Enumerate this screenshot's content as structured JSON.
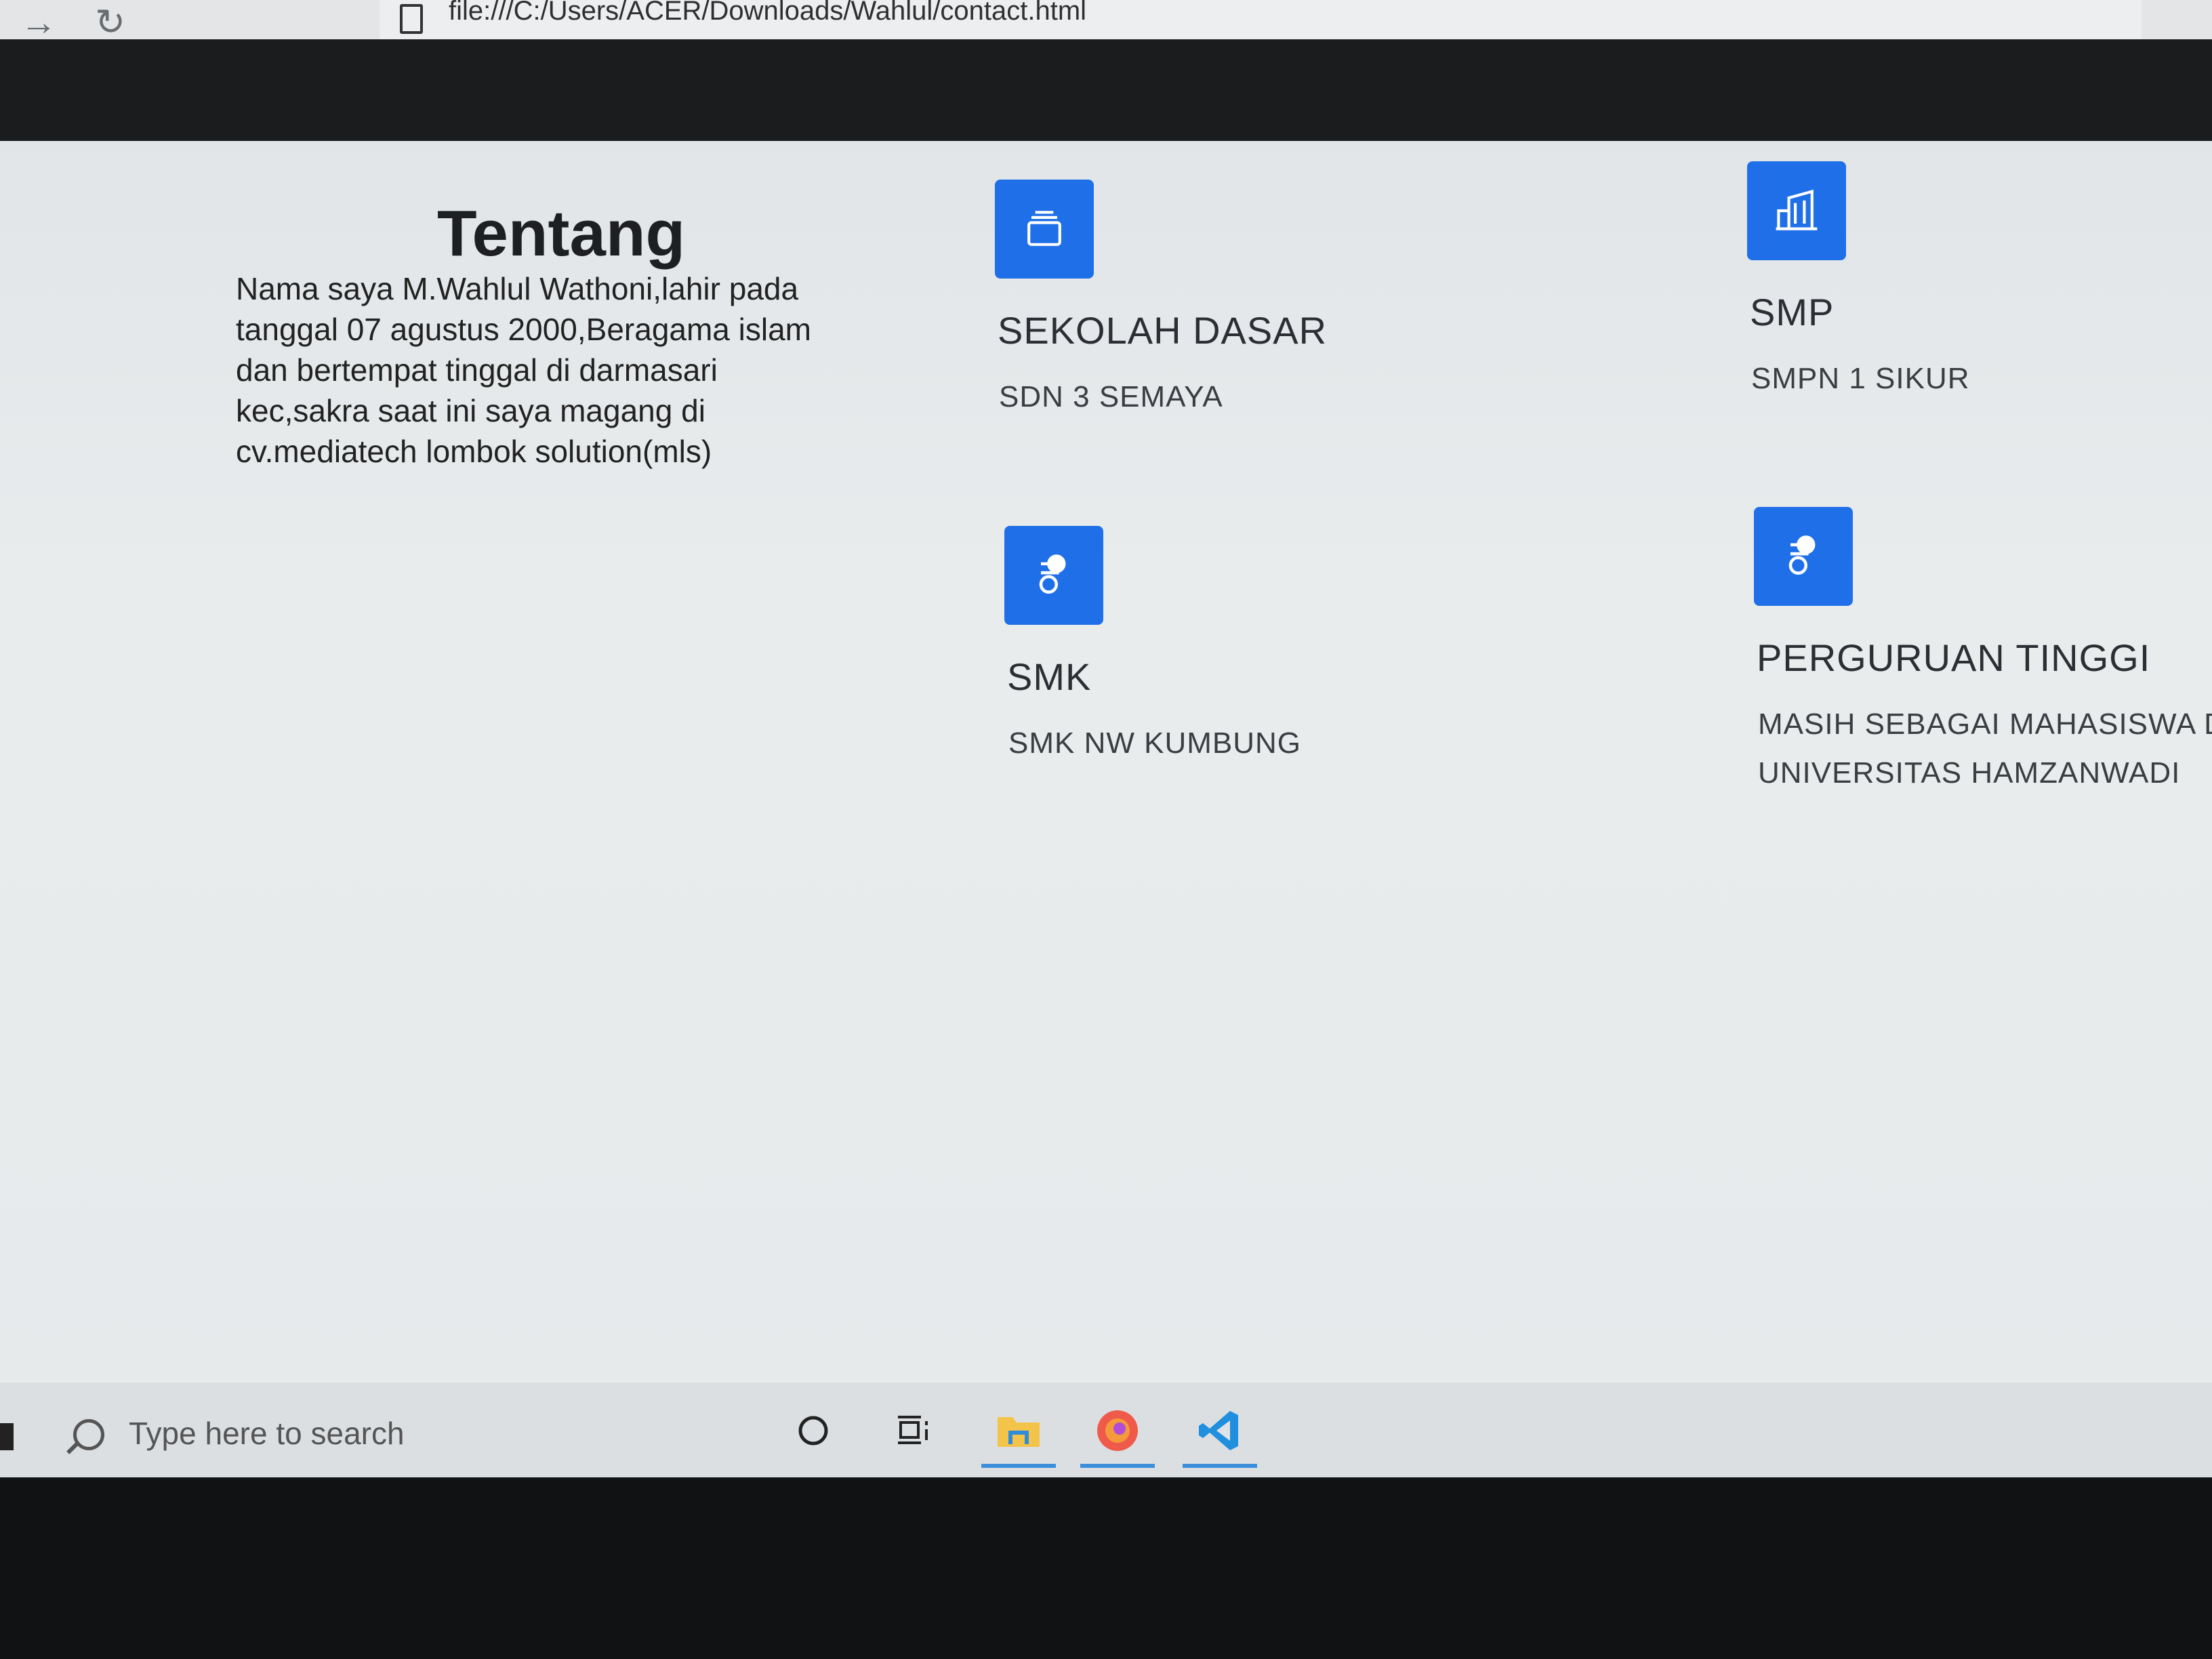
{
  "browser": {
    "url": "file:///C:/Users/ACER/Downloads/Wahlul/contact.html"
  },
  "about": {
    "title": "Tentang",
    "lines": [
      "Nama saya M.Wahlul Wathoni,lahir pada",
      "tanggal 07 agustus 2000,Beragama islam",
      "dan bertempat tinggal di darmasari",
      "kec,sakra saat ini saya magang di",
      "cv.mediatech lombok solution(mls)"
    ]
  },
  "education": {
    "sd": {
      "title": "SEKOLAH DASAR",
      "school": "SDN 3 SEMAYA",
      "icon": "archive-icon"
    },
    "smp": {
      "title": "SMP",
      "school": "SMPN 1 SIKUR",
      "icon": "building-icon"
    },
    "smk": {
      "title": "SMK",
      "school": "SMK NW KUMBUNG",
      "icon": "node-icon"
    },
    "pt": {
      "title": "PERGURUAN TINGGI",
      "school_line1": "MASIH SEBAGAI MAHASISWA D",
      "school_line2": "UNIVERSITAS HAMZANWADI",
      "icon": "node-icon"
    }
  },
  "taskbar": {
    "search_placeholder": "Type here to search"
  },
  "colors": {
    "accent": "#1f6fe8",
    "navbar": "#1a1c1e"
  }
}
